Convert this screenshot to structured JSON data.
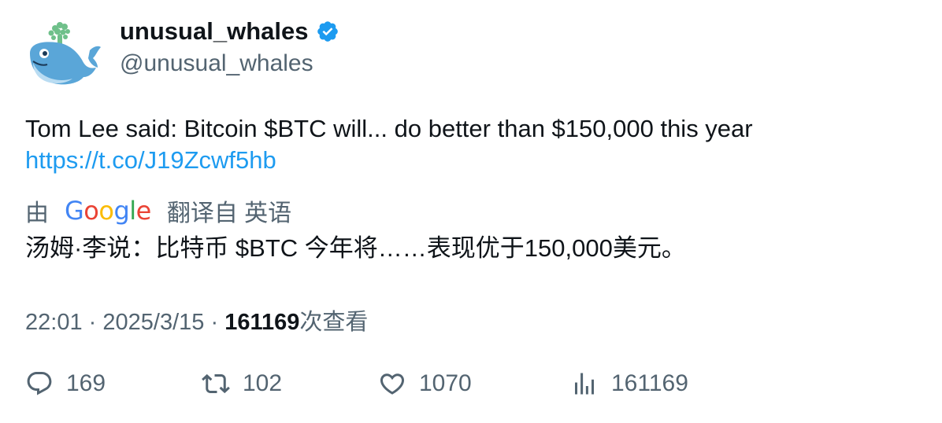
{
  "author": {
    "display_name": "unusual_whales",
    "handle": "@unusual_whales",
    "verified": true,
    "avatar_icon": "whale-icon"
  },
  "tweet": {
    "text": "Tom Lee said: Bitcoin $BTC will... do better than $150,000 this year",
    "link": "https://t.co/J19Zcwf5hb"
  },
  "translation": {
    "prefix": "由",
    "provider": "Google",
    "suffix": "翻译自 英语",
    "text": "汤姆·李说：比特币 $BTC 今年将……表现优于150,000美元。"
  },
  "meta": {
    "time": "22:01",
    "sep1": "·",
    "date": "2025/3/15",
    "sep2": "·",
    "views_count": "161169",
    "views_label": "次查看"
  },
  "actions": {
    "replies": "169",
    "retweets": "102",
    "likes": "1070",
    "views": "161169"
  },
  "colors": {
    "link": "#1d9bf0",
    "secondary": "#536471",
    "primary": "#0f1419",
    "verified": "#1d9bf0"
  }
}
